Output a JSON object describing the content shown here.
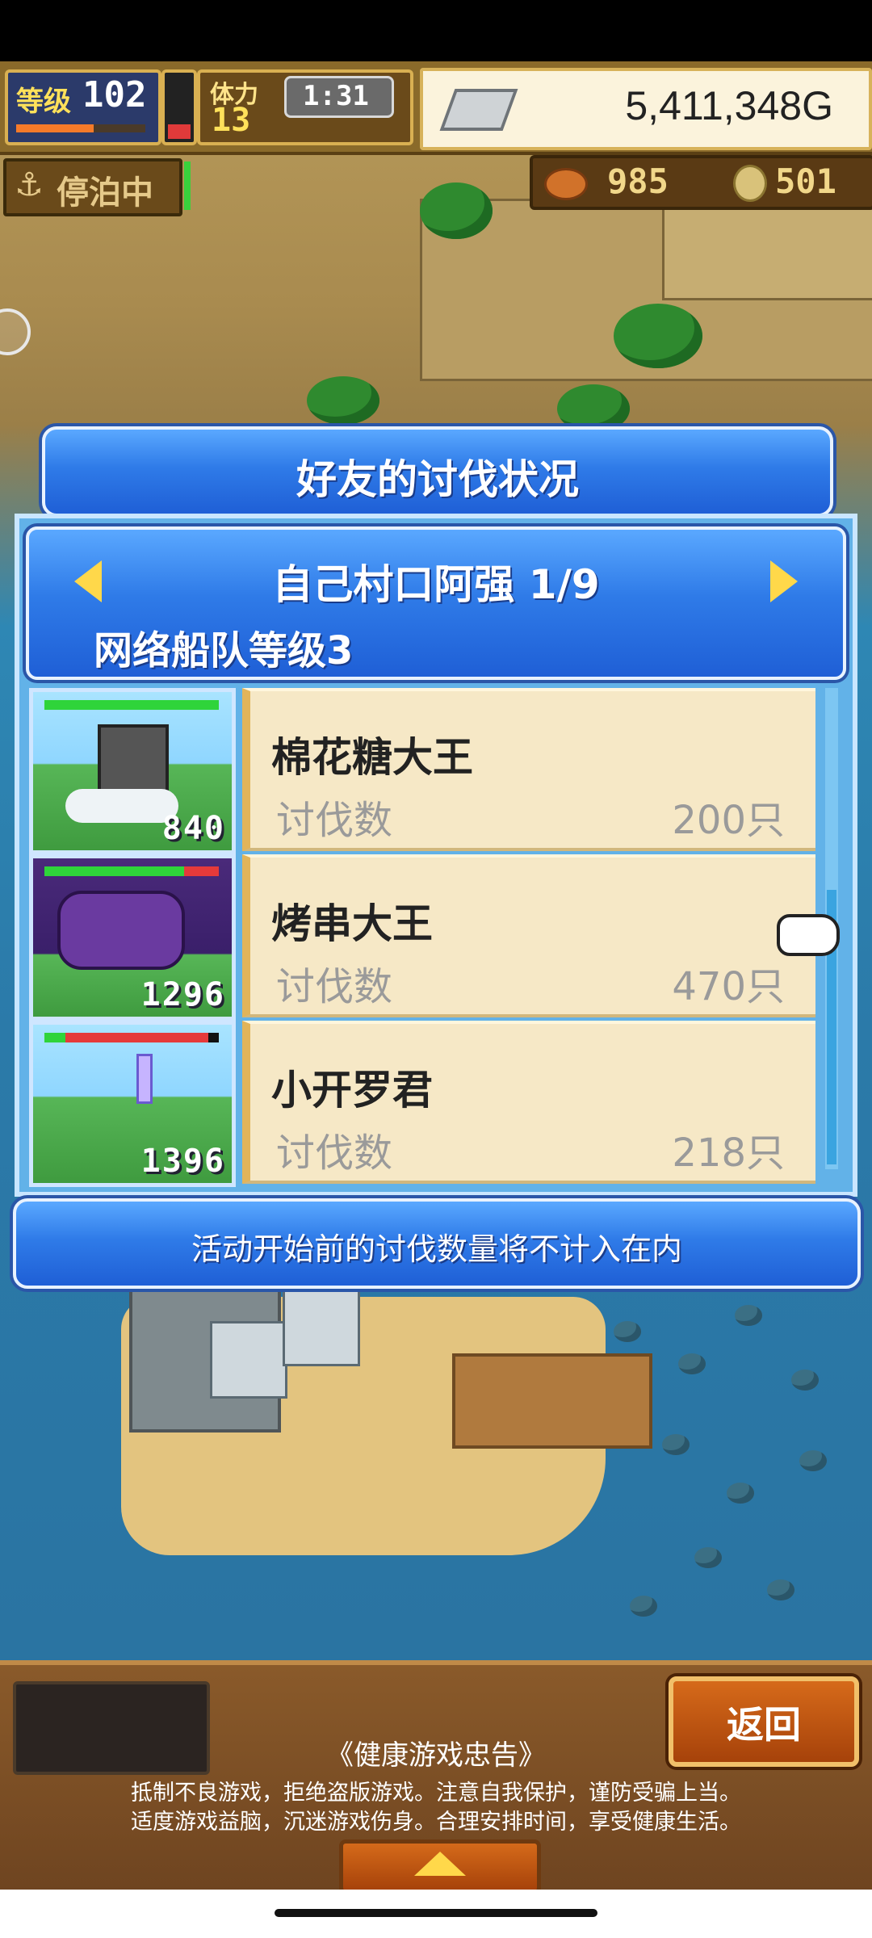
{
  "status_bar": {},
  "hud": {
    "level_label": "等级",
    "level_value": "102",
    "stamina_label": "体力",
    "stamina_value": "13",
    "timer": "1:31",
    "gold": "5,411,348G",
    "anchored_label": "停泊中",
    "food_count": "985",
    "coin_count": "501"
  },
  "dialog": {
    "title": "好友的讨伐状况",
    "friend_name_page": "自己村口阿强 1/9",
    "fleet_level": "网络船队等级3",
    "rows": [
      {
        "name": "棉花糖大王",
        "label": "讨伐数",
        "count": "200只",
        "thumb_number": "840"
      },
      {
        "name": "烤串大王",
        "label": "讨伐数",
        "count": "470只",
        "thumb_number": "1296"
      },
      {
        "name": "小开罗君",
        "label": "讨伐数",
        "count": "218只",
        "thumb_number": "1396"
      }
    ],
    "note": "活动开始前的讨伐数量将不计入在内"
  },
  "footer": {
    "back_button": "返回",
    "health_title": "《健康游戏忠告》",
    "health_line1": "抵制不良游戏，拒绝盗版游戏。注意自我保护，谨防受骗上当。",
    "health_line2": "适度游戏益脑，沉迷游戏伤身。合理安排时间，享受健康生活。"
  },
  "colors": {
    "accent_blue": "#2f7be8",
    "card_bg": "#f6e8c6",
    "gold_frame": "#d9b052"
  }
}
